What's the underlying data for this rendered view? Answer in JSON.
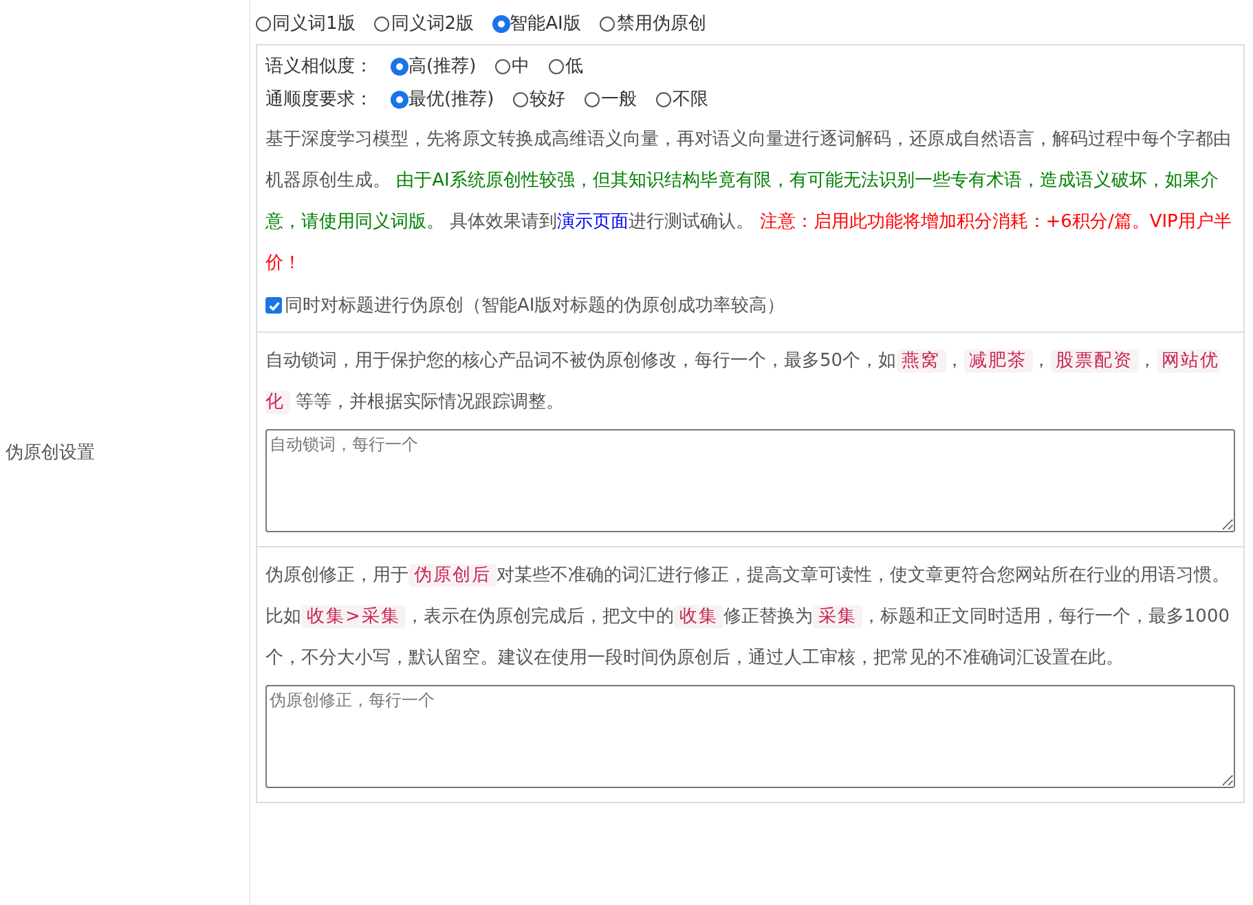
{
  "section_label": "伪原创设置",
  "modes": [
    {
      "label": "同义词1版",
      "selected": false
    },
    {
      "label": "同义词2版",
      "selected": false
    },
    {
      "label": "智能AI版",
      "selected": true
    },
    {
      "label": "禁用伪原创",
      "selected": false
    }
  ],
  "settings": [
    {
      "label": "语义相似度：",
      "options": [
        {
          "label": "高(推荐)",
          "selected": true
        },
        {
          "label": "中",
          "selected": false
        },
        {
          "label": "低",
          "selected": false
        }
      ]
    },
    {
      "label": "通顺度要求：",
      "options": [
        {
          "label": "最优(推荐)",
          "selected": true
        },
        {
          "label": "较好",
          "selected": false
        },
        {
          "label": "一般",
          "selected": false
        },
        {
          "label": "不限",
          "selected": false
        }
      ]
    }
  ],
  "description": [
    {
      "kind": "plain",
      "text": "基于深度学习模型，先将原文转换成高维语义向量，再对语义向量进行逐词解码，还原成自然语言，解码过程中每个字都由机器原创生成。 "
    },
    {
      "kind": "notice",
      "text": "由于AI系统原创性较强，但其知识结构毕竟有限，有可能无法识别一些专有术语，造成语义破坏，如果介意，请使用同义词版。"
    },
    {
      "kind": "plain",
      "text": " 具体效果请到"
    },
    {
      "kind": "link",
      "text": "演示页面"
    },
    {
      "kind": "plain",
      "text": "进行测试确认。 "
    },
    {
      "kind": "warning",
      "text": "注意：启用此功能将增加积分消耗：+6积分/篇。VIP用户半价！"
    }
  ],
  "title_option": {
    "label": "同时对标题进行伪原创（智能AI版对标题的伪原创成功率较高）",
    "checked": true
  },
  "auto_lock": {
    "description": [
      {
        "kind": "plain",
        "text": "自动锁词，用于保护您的核心产品词不被伪原创修改，每行一个，最多50个，如"
      },
      {
        "kind": "code",
        "text": "燕窝"
      },
      {
        "kind": "plain",
        "text": "，"
      },
      {
        "kind": "code",
        "text": "减肥茶"
      },
      {
        "kind": "plain",
        "text": "，"
      },
      {
        "kind": "code",
        "text": "股票配资"
      },
      {
        "kind": "plain",
        "text": "，"
      },
      {
        "kind": "code",
        "text": "网站优化"
      },
      {
        "kind": "plain",
        "text": " 等等，并根据实际情况跟踪调整。"
      }
    ],
    "placeholder": "自动锁词，每行一个"
  },
  "correction": {
    "description": [
      {
        "kind": "plain",
        "text": "伪原创修正，用于"
      },
      {
        "kind": "code",
        "text": "伪原创后"
      },
      {
        "kind": "plain",
        "text": "对某些不准确的词汇进行修正，提高文章可读性，使文章更符合您网站所在行业的用语习惯。比如"
      },
      {
        "kind": "code",
        "text": "收集>采集"
      },
      {
        "kind": "plain",
        "text": "，表示在伪原创完成后，把文中的"
      },
      {
        "kind": "code",
        "text": "收集"
      },
      {
        "kind": "plain",
        "text": "修正替换为"
      },
      {
        "kind": "code",
        "text": "采集"
      },
      {
        "kind": "plain",
        "text": "，标题和正文同时适用，每行一个，最多1000个，不分大小写，默认留空。建议在使用一段时间伪原创后，通过人工审核，把常见的不准确词汇设置在此。"
      }
    ],
    "placeholder": "伪原创修正，每行一个"
  }
}
